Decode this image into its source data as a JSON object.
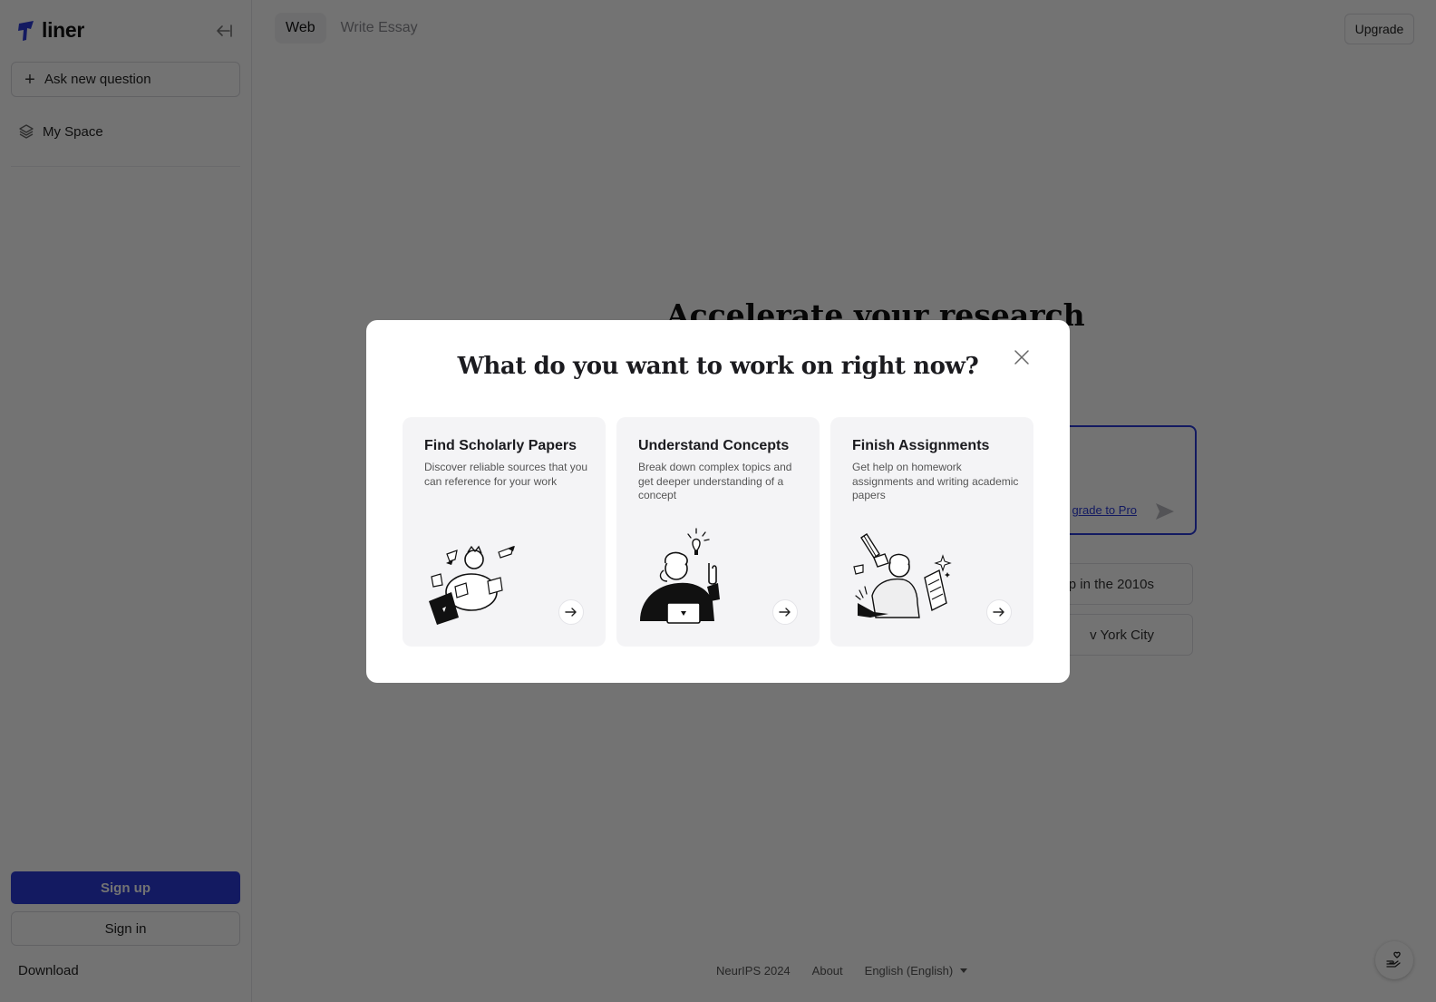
{
  "brand": {
    "name": "liner",
    "accent_color": "#2b3bd8"
  },
  "sidebar": {
    "ask_new_question": "Ask new question",
    "items": [
      {
        "label": "My Space",
        "icon": "layers-icon"
      }
    ],
    "signup_label": "Sign up",
    "signin_label": "Sign in",
    "download_label": "Download"
  },
  "header": {
    "tabs": [
      {
        "label": "Web",
        "active": true
      },
      {
        "label": "Write Essay",
        "active": false
      }
    ],
    "upgrade_label": "Upgrade"
  },
  "main": {
    "hero_title": "Accelerate your research",
    "upgrade_pro_link": "grade to Pro",
    "suggestions": [
      {
        "label": "p in the 2010s"
      },
      {
        "label": "v York City"
      }
    ]
  },
  "footer": {
    "links": [
      "NeurIPS 2024",
      "About"
    ],
    "language": "English (English)"
  },
  "modal": {
    "title": "What do you want to work on right now?",
    "cards": [
      {
        "title": "Find Scholarly Papers",
        "description": "Discover reliable sources that you can reference for your work",
        "illustration": "person-with-laptop-papers"
      },
      {
        "title": "Understand Concepts",
        "description": "Break down complex topics and get deeper understanding of a concept",
        "illustration": "person-with-lightbulb"
      },
      {
        "title": "Finish Assignments",
        "description": "Get help on homework assignments and writing academic papers",
        "illustration": "person-writing-assignment"
      }
    ]
  }
}
